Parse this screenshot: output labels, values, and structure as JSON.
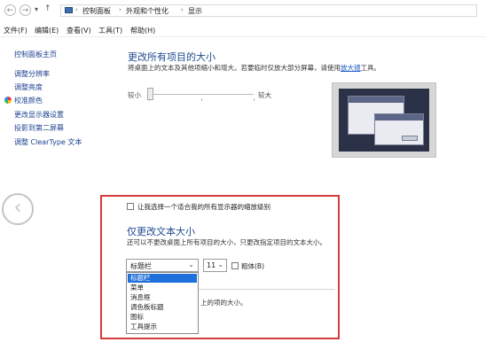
{
  "addressbar": {
    "back_glyph": "←",
    "forward_glyph": "→",
    "history_glyph": "▾",
    "up_glyph": "↑",
    "breadcrumbs": [
      "控制面板",
      "外观和个性化",
      "显示"
    ],
    "separator": "›"
  },
  "menubar": {
    "items": [
      "文件(F)",
      "编辑(E)",
      "查看(V)",
      "工具(T)",
      "帮助(H)"
    ]
  },
  "sidebar": {
    "items": [
      {
        "label": "控制面板主页"
      },
      {
        "label": "调整分辨率"
      },
      {
        "label": "调整亮度"
      },
      {
        "label": "校准颜色"
      },
      {
        "label": "更改显示器设置"
      },
      {
        "label": "投影到第二屏幕"
      },
      {
        "label": "调整 ClearType 文本"
      }
    ]
  },
  "main": {
    "heading": "更改所有项目的大小",
    "description_prefix": "将桌面上的文本及其他项缩小和增大。若要临时仅放大部分屏幕，请使用",
    "magnifier_link": "放大镜",
    "description_suffix": "工具。",
    "slider_min_label": "较小",
    "slider_max_label": "较大",
    "slider_level": 0
  },
  "text_settings": {
    "custom_scaling_checkbox_label": "让我选择一个适合我的所有显示器的缩放级别",
    "custom_scaling_checked": false,
    "heading": "仅更改文本大小",
    "description": "还可以不更改桌面上所有项目的大小，只更改指定项目的文本大小。",
    "element_select_value": "标题栏",
    "size_select_value": "11",
    "bold_label": "粗体(B)",
    "bold_checked": false,
    "dropdown_options": [
      "标题栏",
      "菜单",
      "消息框",
      "调色板标题",
      "图标",
      "工具提示"
    ],
    "selected_option_index": 0,
    "partial_text": "上的项的大小。"
  },
  "colors": {
    "highlight_border": "#d63b3b",
    "heading": "#1e4b8f",
    "link": "#1b57c2",
    "selection": "#1e6fd9"
  }
}
